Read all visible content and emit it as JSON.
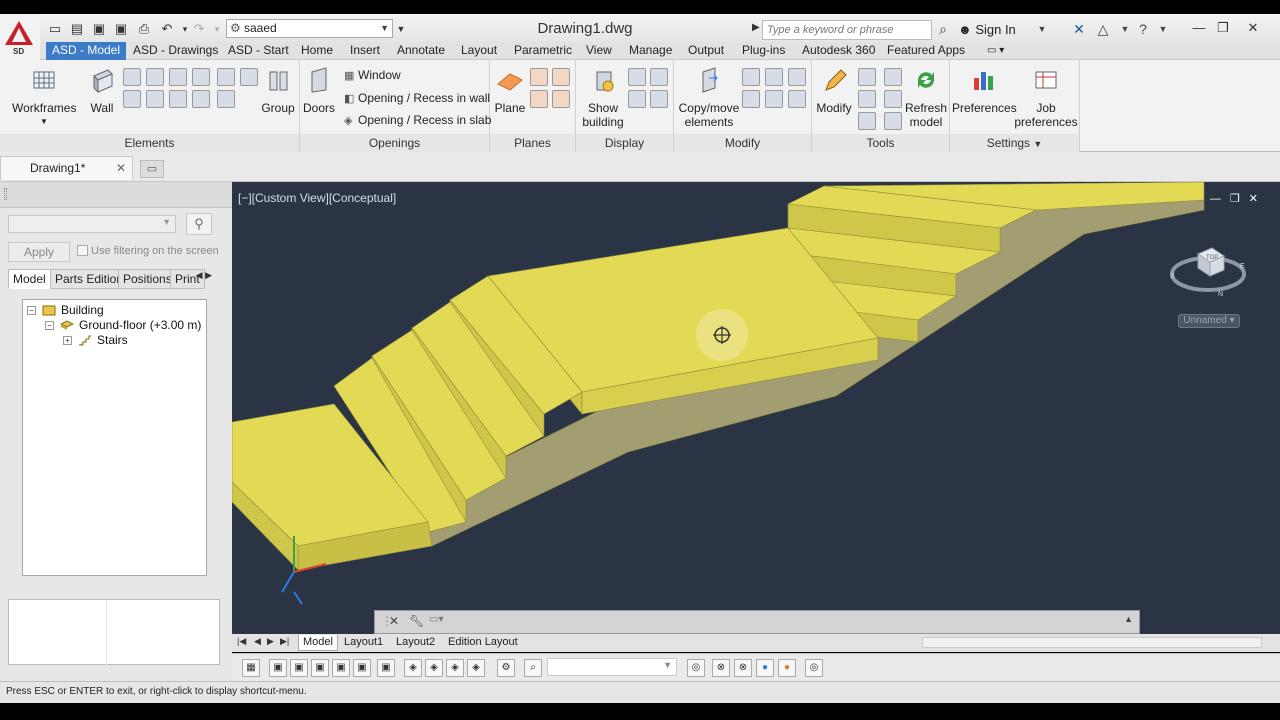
{
  "app": {
    "workspace": "saaed",
    "doc_title": "Drawing1.dwg",
    "search_placeholder": "Type a keyword or phrase",
    "sign_in": "Sign In",
    "logo_subtext": "SD"
  },
  "ribbon_tabs": [
    "ASD - Model",
    "ASD - Drawings",
    "ASD - Start",
    "Home",
    "Insert",
    "Annotate",
    "Layout",
    "Parametric",
    "View",
    "Manage",
    "Output",
    "Plug-ins",
    "Autodesk 360",
    "Featured Apps"
  ],
  "ribbon": {
    "elements": {
      "title": "Elements",
      "workframes": "Workframes",
      "wall": "Wall",
      "group": "Group"
    },
    "openings": {
      "title": "Openings",
      "doors": "Doors",
      "window": "Window",
      "opening_wall": "Opening / Recess in wall",
      "opening_slab": "Opening / Recess in slab"
    },
    "planes": {
      "title": "Planes",
      "plane": "Plane"
    },
    "display": {
      "title": "Display",
      "show_building_1": "Show",
      "show_building_2": "building"
    },
    "modify": {
      "title": "Modify",
      "copy_1": "Copy/move",
      "copy_2": "elements"
    },
    "tools": {
      "title": "Tools",
      "modify": "Modify",
      "refresh_1": "Refresh",
      "refresh_2": "model"
    },
    "settings": {
      "title": "Settings",
      "preferences": "Preferences",
      "job_1": "Job",
      "job_2": "preferences"
    }
  },
  "document_tab": "Drawing1*",
  "left_panel": {
    "apply": "Apply",
    "use_filter": "Use filtering on the screen",
    "tabs": [
      "Model",
      "Parts Edition",
      "Positions",
      "Print"
    ],
    "tree": {
      "building": "Building",
      "ground_floor": "Ground-floor  (+3.00 m)",
      "stairs": "Stairs"
    }
  },
  "viewport": {
    "label": "[−][Custom View][Conceptual]",
    "viewcube_top": "TOP",
    "viewcube_s": "S",
    "viewcube_e": "E",
    "viewcube_n": "N",
    "unnamed": "Unnamed",
    "stair_color": "#e2da55",
    "background": "#2a3445"
  },
  "layout_tabs": [
    "Model",
    "Layout1",
    "Layout2",
    "Edition Layout"
  ],
  "prompt": "Press ESC or ENTER to exit, or right-click to display shortcut-menu."
}
